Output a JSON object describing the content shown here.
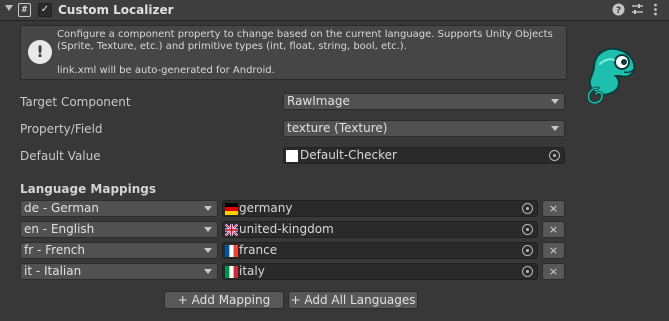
{
  "header": {
    "title": "Custom Localizer",
    "script_icon_glyph": "#",
    "checkbox_glyph": "✓",
    "icons": [
      "help-icon",
      "presets-icon",
      "more-icon"
    ]
  },
  "helpbox": {
    "line1": "Configure a component property to change based on the current language. Supports Unity Objects (Sprite, Texture, etc.) and primitive types (int, float, string, bool, etc.).",
    "line2": "link.xml will be auto-generated for Android.",
    "icon_glyph": "!"
  },
  "properties": {
    "target_component": {
      "label": "Target Component",
      "value": "RawImage"
    },
    "property_field": {
      "label": "Property/Field",
      "value": "texture (Texture)"
    },
    "default_value": {
      "label": "Default Value",
      "value": "Default-Checker"
    }
  },
  "mappings": {
    "title": "Language Mappings",
    "rows": [
      {
        "language": "de - German",
        "asset": "germany",
        "flag": "germany-flag-icon"
      },
      {
        "language": "en - English",
        "asset": "united-kingdom",
        "flag": "uk-flag-icon"
      },
      {
        "language": "fr - French",
        "asset": "france",
        "flag": "france-flag-icon"
      },
      {
        "language": "it - Italian",
        "asset": "italy",
        "flag": "italy-flag-icon"
      }
    ],
    "remove_glyph": "×",
    "add_mapping_label": "+ Add Mapping",
    "add_all_label": "+ Add All Languages"
  },
  "colors": {
    "background": "#383838",
    "header": "#3e3e3e",
    "field": "#2a2a2a",
    "dropdown": "#515151",
    "logo_teal": "#1fbfae"
  }
}
